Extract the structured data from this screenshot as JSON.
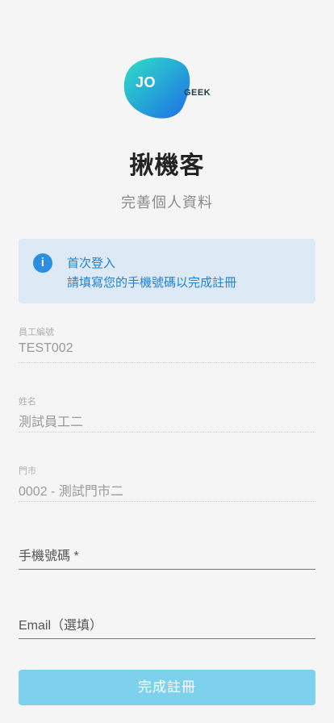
{
  "brand": {
    "logo_primary": "JO",
    "logo_secondary": "GEEK",
    "gradient_start": "#2fe0c4",
    "gradient_end": "#1d6fe8"
  },
  "header": {
    "title": "揪機客",
    "subtitle": "完善個人資料"
  },
  "notice": {
    "icon": "info-icon",
    "title": "首次登入",
    "message": "請填寫您的手機號碼以完成註冊",
    "color": "#1f82d6",
    "background": "#dde9f5"
  },
  "profile": {
    "employee_id": {
      "label": "員工編號",
      "value": "TEST002"
    },
    "name": {
      "label": "姓名",
      "value": "測試員工二"
    },
    "store": {
      "label": "門市",
      "value": "0002 - 測試門市二"
    }
  },
  "form": {
    "phone": {
      "placeholder": "手機號碼 *",
      "value": ""
    },
    "email": {
      "placeholder": "Email（選填）",
      "value": ""
    }
  },
  "actions": {
    "submit_label": "完成註冊",
    "submit_color": "#7dd1ed"
  }
}
